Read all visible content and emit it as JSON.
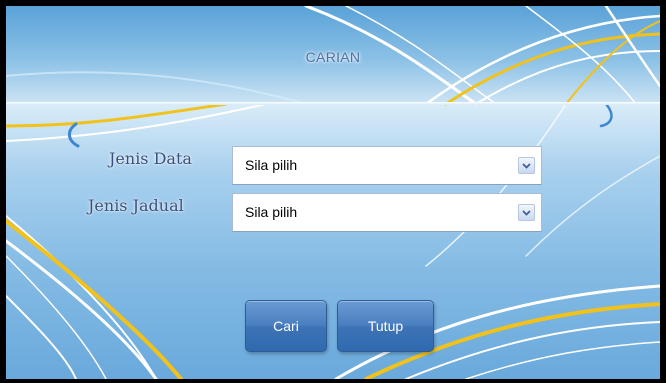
{
  "header": {
    "title": "CARIAN"
  },
  "form": {
    "fields": [
      {
        "label": "Jenis Data",
        "selected": "Sila pilih"
      },
      {
        "label": "Jenis Jadual",
        "selected": "Sila pilih"
      }
    ]
  },
  "buttons": {
    "search_label": "Cari",
    "close_label": "Tutup"
  },
  "colors": {
    "background_blue": "#7fb6df",
    "accent_yellow": "#f2c21a",
    "button_blue": "#3e73b6",
    "label_color": "#3a4f7a"
  },
  "icons": {
    "dropdown": "chevron-down-icon"
  }
}
